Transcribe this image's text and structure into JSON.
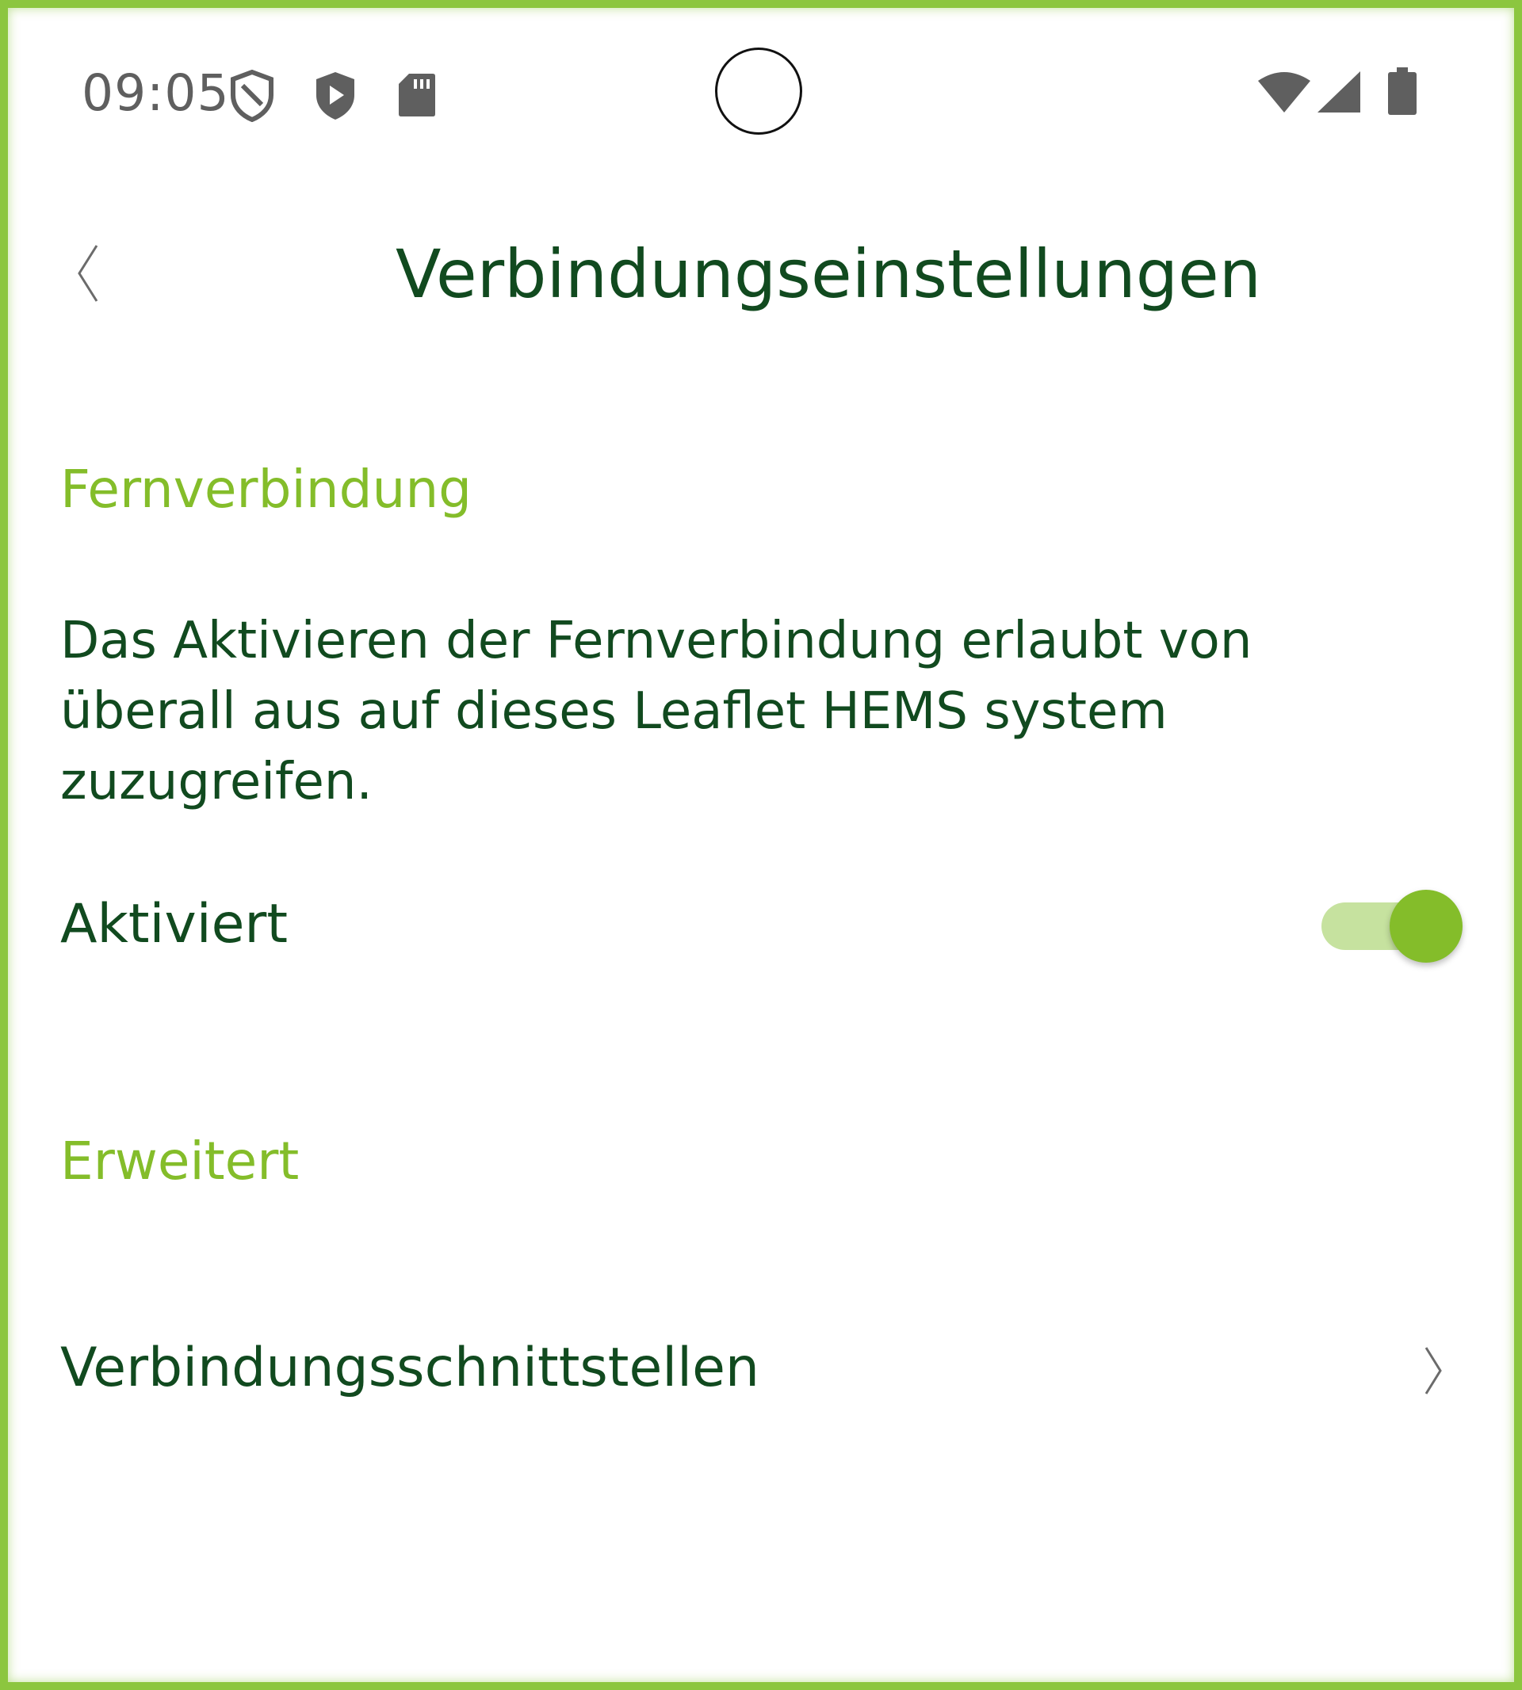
{
  "status_bar": {
    "time": "09:05",
    "icons": [
      "shield-outline-icon",
      "shield-play-icon",
      "sd-card-icon",
      "wifi-icon",
      "cellular-signal-icon",
      "battery-icon"
    ]
  },
  "header": {
    "title": "Verbindungseinstellungen",
    "back_icon": "chevron-left-icon"
  },
  "sections": {
    "remote": {
      "header": "Fernverbindung",
      "description": "Das Aktivieren der Fernverbindung erlaubt von überall aus auf dieses Leaflet HEMS system zuzugreifen.",
      "toggle_label": "Aktiviert",
      "toggle_on": true
    },
    "advanced": {
      "header": "Erweitert",
      "item_label": "Verbindungsschnittstellen",
      "item_icon": "chevron-right-icon"
    }
  },
  "colors": {
    "accent": "#84bd2a",
    "text_primary": "#114a1f",
    "toggle_track": "#c6e29f",
    "frame": "#8cc63f"
  }
}
